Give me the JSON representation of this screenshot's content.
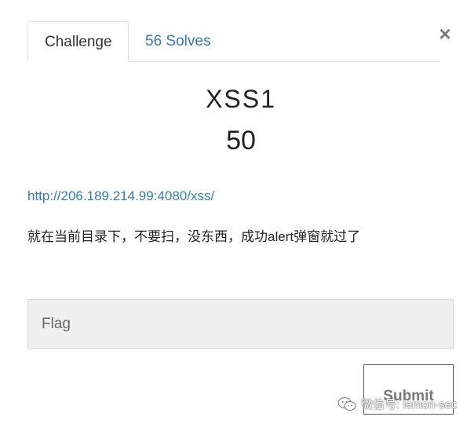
{
  "tabs": {
    "challenge": "Challenge",
    "solves": "56 Solves"
  },
  "close_icon": "×",
  "challenge": {
    "name": "XSS1",
    "points": "50",
    "link": "http://206.189.214.99:4080/xss/",
    "description": "就在当前目录下，不要扫，没东西，成功alert弹窗就过了"
  },
  "form": {
    "flag_placeholder": "Flag",
    "flag_value": "",
    "submit_label": "Submit"
  },
  "watermark": {
    "text": "微信号: lemon-sec",
    "icon": "wechat-icon"
  },
  "colors": {
    "link": "#337ab7",
    "input_bg": "#efefef"
  }
}
